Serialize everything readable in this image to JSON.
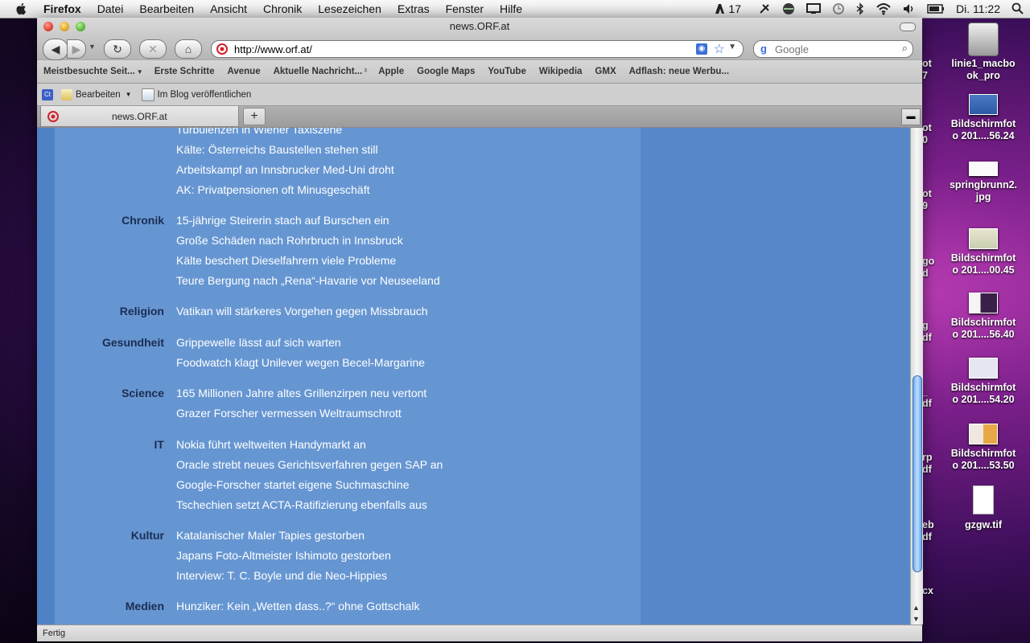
{
  "menubar": {
    "app": "Firefox",
    "items": [
      "Datei",
      "Bearbeiten",
      "Ansicht",
      "Chronik",
      "Lesezeichen",
      "Extras",
      "Fenster",
      "Hilfe"
    ],
    "status_number": "17",
    "clock": "Di. 11:22"
  },
  "window": {
    "title": "news.ORF.at",
    "url": "http://www.orf.at/",
    "search_placeholder": "Google"
  },
  "bookmarks": [
    "Meistbesuchte Seit...",
    "Erste Schritte",
    "Avenue",
    "Aktuelle Nachricht...",
    "Apple",
    "Google Maps",
    "YouTube",
    "Wikipedia",
    "GMX",
    "Adflash: neue Werbu..."
  ],
  "toolbar2": {
    "edit": "Bearbeiten",
    "blog": "Im Blog veröffentlichen"
  },
  "tab": {
    "label": "news.ORF.at"
  },
  "status": "Fertig",
  "sections": [
    {
      "category": "",
      "items": [
        "Turbulenzen in Wiener Taxiszene",
        "Kälte: Österreichs Baustellen stehen still",
        "Arbeitskampf an Innsbrucker Med-Uni droht",
        "AK: Privatpensionen oft Minusgeschäft"
      ]
    },
    {
      "category": "Chronik",
      "items": [
        "15-jährige Steirerin stach auf Burschen ein",
        "Große Schäden nach Rohrbruch in Innsbruck",
        "Kälte beschert Dieselfahrern viele Probleme",
        "Teure Bergung nach „Rena“-Havarie vor Neuseeland"
      ]
    },
    {
      "category": "Religion",
      "items": [
        "Vatikan will stärkeres Vorgehen gegen Missbrauch"
      ]
    },
    {
      "category": "Gesundheit",
      "items": [
        "Grippewelle lässt auf sich warten",
        "Foodwatch klagt Unilever wegen Becel-Margarine"
      ]
    },
    {
      "category": "Science",
      "items": [
        "165 Millionen Jahre altes Grillenzirpen neu vertont",
        "Grazer Forscher vermessen Weltraumschrott"
      ]
    },
    {
      "category": "IT",
      "items": [
        "Nokia führt weltweiten Handymarkt an",
        "Oracle strebt neues Gerichtsverfahren gegen SAP an",
        "Google-Forscher startet eigene Suchmaschine",
        "Tschechien setzt ACTA-Ratifizierung ebenfalls aus"
      ]
    },
    {
      "category": "Kultur",
      "items": [
        "Katalanischer Maler Tapies gestorben",
        "Japans Foto-Altmeister Ishimoto gestorben",
        "Interview: T. C. Boyle und die Neo-Hippies"
      ]
    },
    {
      "category": "Medien",
      "items": [
        "Hunziker: Kein „Wetten dass..?“ ohne Gottschalk"
      ]
    }
  ],
  "desktop": [
    {
      "name": "linie1_macbook_pro",
      "line1": "linie1_macbo",
      "line2": "ok_pro",
      "kind": "drive"
    },
    {
      "name": "Bildschirmfoto 201....56.24",
      "line1": "Bildschirmfot",
      "line2": "o 201....56.24",
      "kind": "image"
    },
    {
      "name": "springbrunn2.jpg",
      "line1": "springbrunn2.",
      "line2": "jpg",
      "kind": "image"
    },
    {
      "name": "Bildschirmfoto 201....00.45",
      "line1": "Bildschirmfot",
      "line2": "o 201....00.45",
      "kind": "image"
    },
    {
      "name": "Bildschirmfoto 201....56.40",
      "line1": "Bildschirmfot",
      "line2": "o 201....56.40",
      "kind": "image"
    },
    {
      "name": "Bildschirmfoto 201....54.20",
      "line1": "Bildschirmfot",
      "line2": "o 201....54.20",
      "kind": "image"
    },
    {
      "name": "Bildschirmfoto 201....53.50",
      "line1": "Bildschirmfot",
      "line2": "o 201....53.50",
      "kind": "image"
    },
    {
      "name": "gzgw.tif",
      "line1": "gzgw.tif",
      "line2": "",
      "kind": "doc"
    }
  ],
  "partial_labels": [
    {
      "line1": "ot",
      "line2": "7"
    },
    {
      "line1": "ot",
      "line2": "0"
    },
    {
      "line1": "ot",
      "line2": "9"
    },
    {
      "line1": "go",
      "line2": "d"
    },
    {
      "line1": "g",
      "line2": "df"
    },
    {
      "line1": "_",
      "line2": "df"
    },
    {
      "line1": "rp",
      "line2": "df"
    },
    {
      "line1": "eb",
      "line2": "df"
    },
    {
      "line1": "cx",
      "line2": ""
    }
  ],
  "colors": {
    "content_bg": "#5b8fcf",
    "category_text": "#1b2d52",
    "item_text": "#ffffff"
  }
}
